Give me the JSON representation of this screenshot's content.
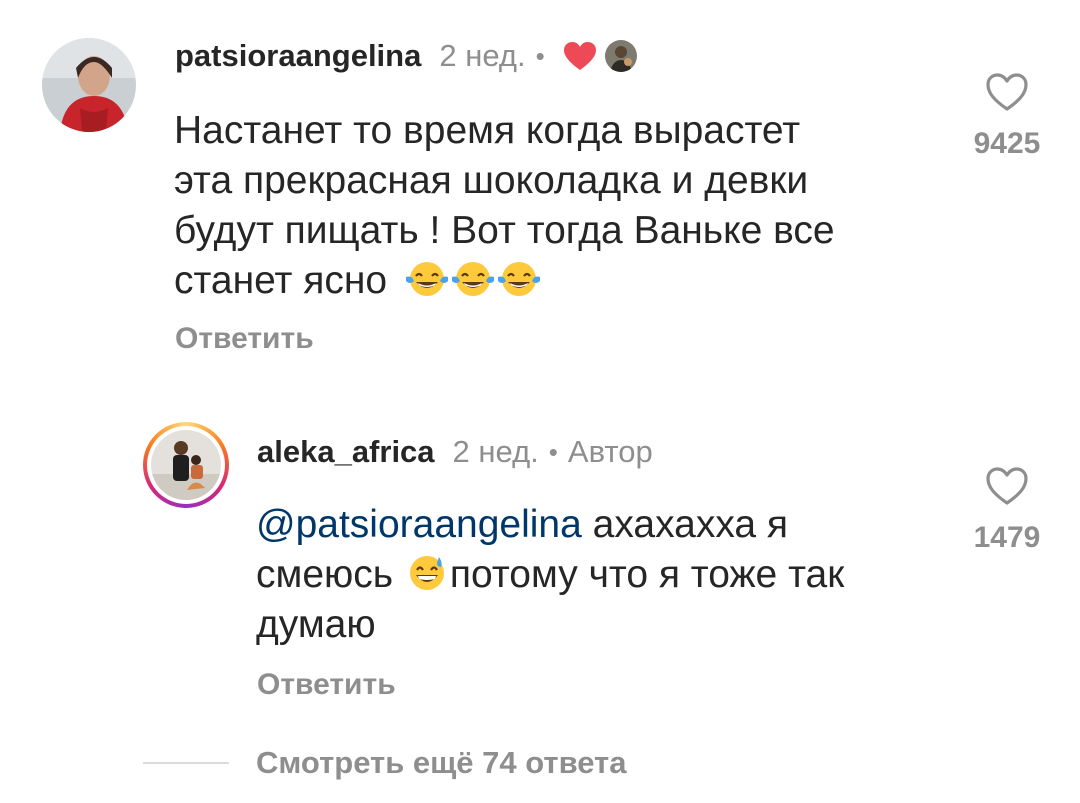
{
  "comments": [
    {
      "username": "patsioraangelina",
      "time": "2 нед.",
      "separator": "•",
      "badge_icons": [
        "heart-filled-red-icon",
        "liked-by-author-avatar-icon"
      ],
      "text_lines": [
        "Настанет то время когда вырастет",
        "эта прекрасная шоколадка и девки",
        "будут пищать ! Вот тогда Ваньке все",
        "станет ясно"
      ],
      "trailing_emojis": [
        "face-with-tears-of-joy-icon",
        "face-with-tears-of-joy-icon",
        "face-with-tears-of-joy-icon"
      ],
      "reply_label": "Ответить",
      "like_count": "9425"
    },
    {
      "username": "aleka_africa",
      "time": "2 нед.",
      "separator": "•",
      "author_label": "Автор",
      "mention": "@patsioraangelina",
      "text_line1_rest": " ахахахха я",
      "text_line2_before": "смеюсь ",
      "text_line2_after": "потому что я тоже так",
      "text_line3": "думаю",
      "inline_emoji": "grinning-face-with-sweat-icon",
      "reply_label": "Ответить",
      "like_count": "1479"
    }
  ],
  "view_more_label": "Смотреть ещё 74 ответа",
  "colors": {
    "text": "#262626",
    "secondary": "#8e8e8e",
    "mention": "#00376b",
    "heart": "#ed4956"
  }
}
